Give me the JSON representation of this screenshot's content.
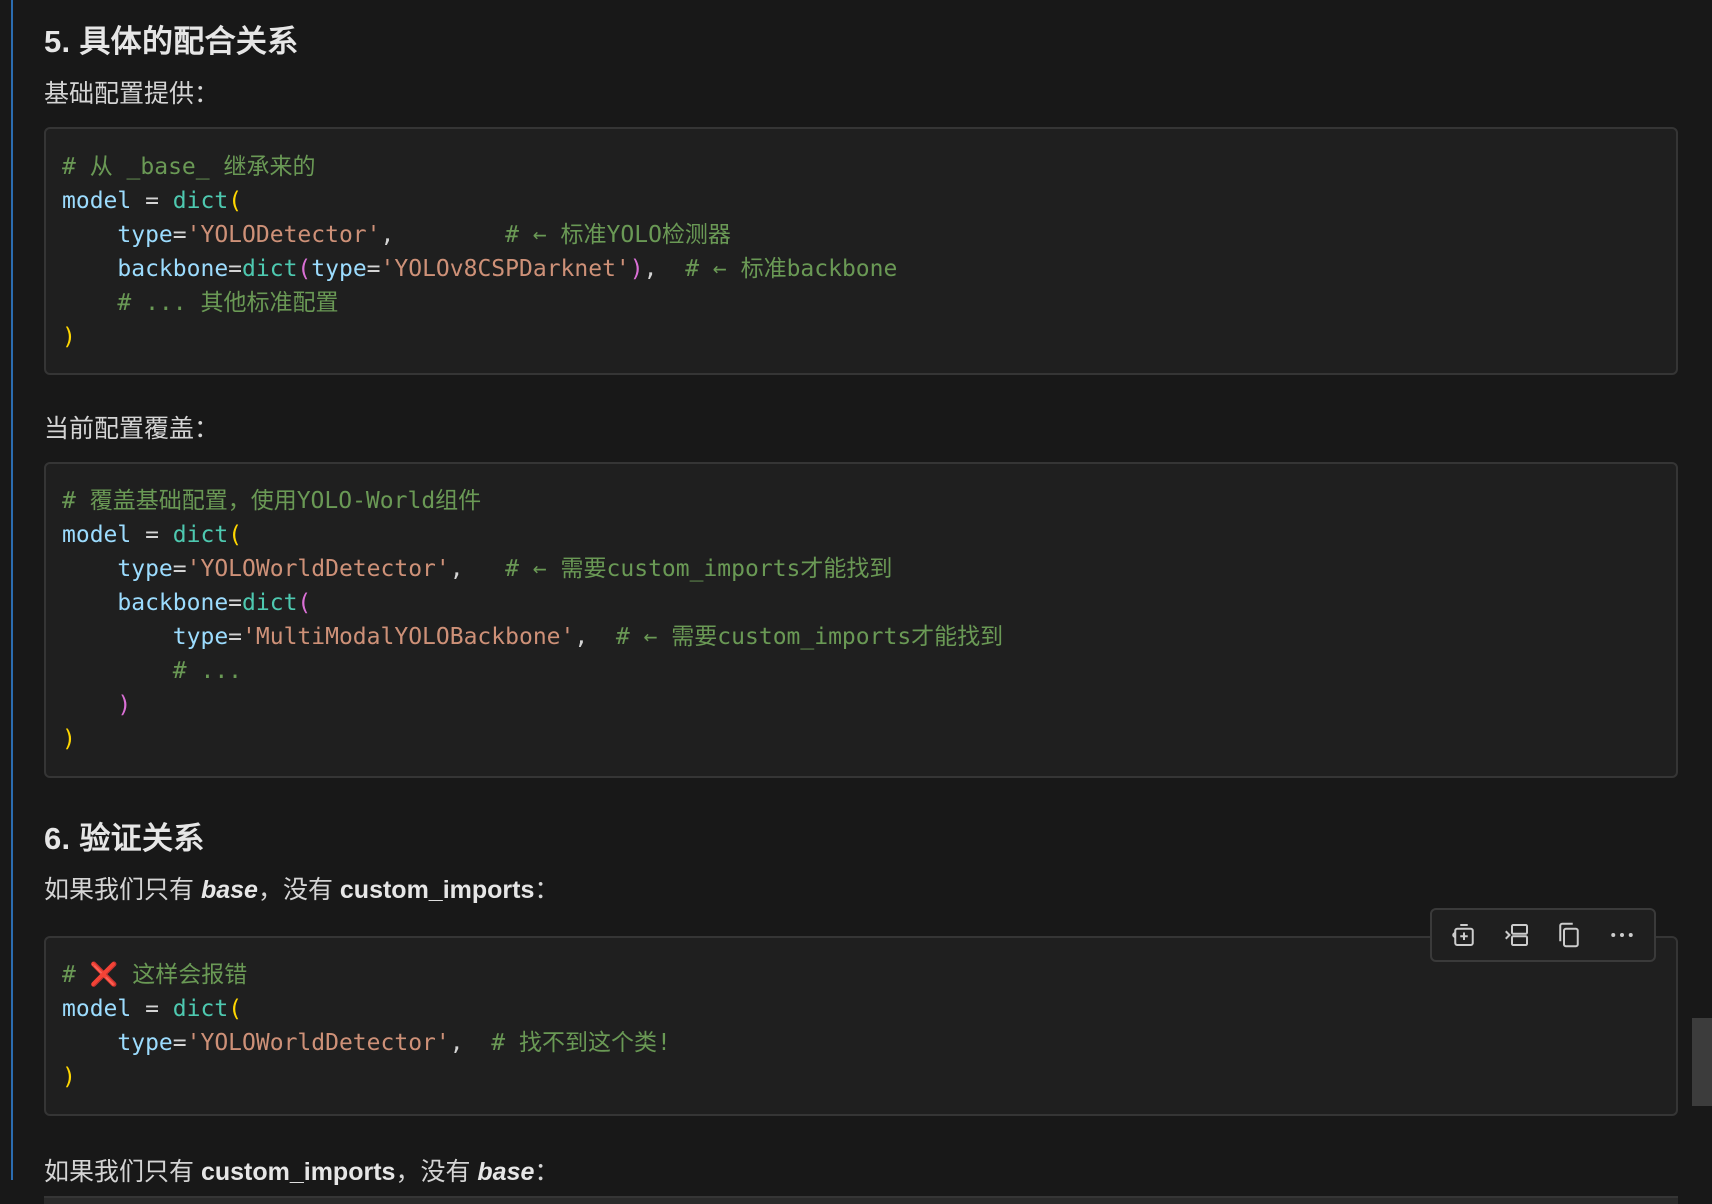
{
  "section5": {
    "title": "5. 具体的配合关系",
    "base_label": "基础配置提供：",
    "current_label": "当前配置覆盖："
  },
  "code1": {
    "l1_comment": "# 从 _base_ 继承来的",
    "l2_ident": "model",
    "l2_op": " = ",
    "l2_fn": "dict",
    "l2_paren": "(",
    "l3_indent": "    ",
    "l3_key": "type",
    "l3_eq": "=",
    "l3_str": "'YOLODetector'",
    "l3_comma": ",        ",
    "l3_comment": "# ← 标准YOLO检测器",
    "l4_indent": "    ",
    "l4_key": "backbone",
    "l4_eq": "=",
    "l4_fn": "dict",
    "l4_paren_open": "(",
    "l4_key2": "type",
    "l4_eq2": "=",
    "l4_str": "'YOLOv8CSPDarknet'",
    "l4_paren_close": ")",
    "l4_comma": ",  ",
    "l4_comment": "# ← 标准backbone",
    "l5_indent": "    ",
    "l5_comment": "# ... 其他标准配置",
    "l6_paren": ")"
  },
  "code2": {
    "l1_comment": "# 覆盖基础配置，使用YOLO-World组件",
    "l2_ident": "model",
    "l2_op": " = ",
    "l2_fn": "dict",
    "l2_paren": "(",
    "l3_indent": "    ",
    "l3_key": "type",
    "l3_eq": "=",
    "l3_str": "'YOLOWorldDetector'",
    "l3_comma": ",   ",
    "l3_comment": "# ← 需要custom_imports才能找到",
    "l4_indent": "    ",
    "l4_key": "backbone",
    "l4_eq": "=",
    "l4_fn": "dict",
    "l4_paren": "(",
    "l5_indent": "        ",
    "l5_key": "type",
    "l5_eq": "=",
    "l5_str": "'MultiModalYOLOBackbone'",
    "l5_comma": ",  ",
    "l5_comment": "# ← 需要custom_imports才能找到",
    "l6_indent": "        ",
    "l6_comment": "# ...",
    "l7_indent": "    ",
    "l7_paren": ")",
    "l8_paren": ")"
  },
  "section6": {
    "title": "6. 验证关系",
    "q1_a": "如果我们只有 ",
    "q1_base": "base",
    "q1_b": "，没有 ",
    "q1_ci": "custom_imports",
    "q1_c": "：",
    "q2_a": "如果我们只有 ",
    "q2_ci": "custom_imports",
    "q2_b": "，没有 ",
    "q2_base": "base",
    "q2_c": "："
  },
  "code3": {
    "l1_hash": "# ",
    "l1_cross": "❌",
    "l1_comment": " 这样会报错",
    "l2_ident": "model",
    "l2_op": " = ",
    "l2_fn": "dict",
    "l2_paren": "(",
    "l3_indent": "    ",
    "l3_key": "type",
    "l3_eq": "=",
    "l3_str": "'YOLOWorldDetector'",
    "l3_comma": ",  ",
    "l3_comment": "# 找不到这个类!",
    "l4_paren": ")"
  },
  "toolbar": {
    "icons": [
      "insert-into-terminal-icon",
      "apply-in-editor-icon",
      "copy-icon",
      "more-icon"
    ]
  },
  "colors": {
    "comment": "#6a9955",
    "string": "#ce9178",
    "identifier": "#9cdcfe",
    "function": "#4ec9b0",
    "bracket_level1": "#ffd700",
    "bracket_level2": "#da70d6",
    "error": "#e5332a"
  }
}
